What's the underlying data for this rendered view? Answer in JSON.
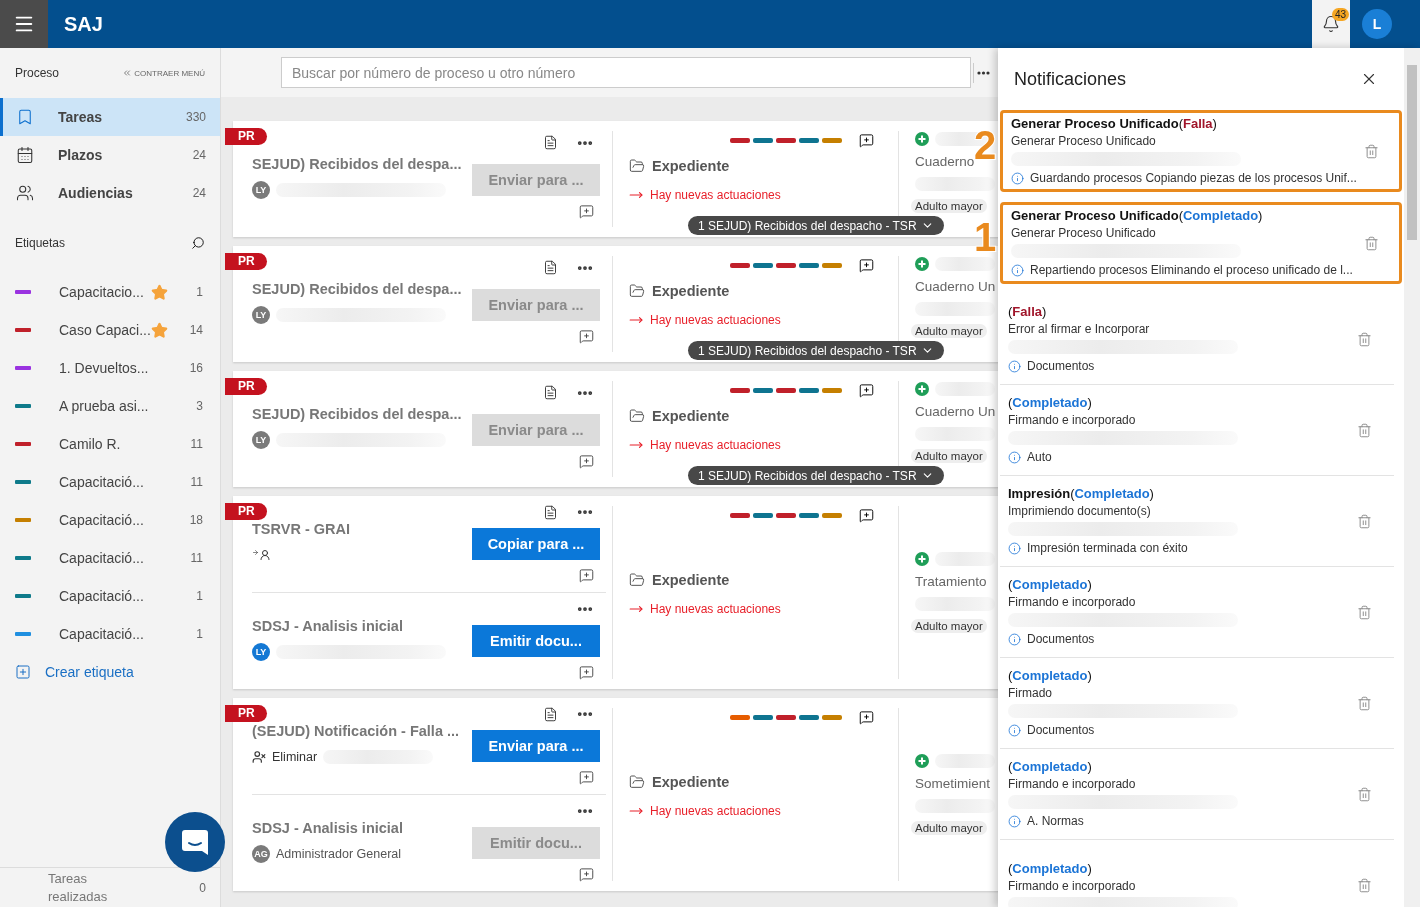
{
  "header": {
    "app_name": "SAJ",
    "bell": {
      "count": "43",
      "selected": true
    },
    "avatar_initial": "L"
  },
  "sidebar": {
    "section_title": "Proceso",
    "collapse_label": "CONTRAER MENÚ",
    "nav": [
      {
        "kind": "tasks",
        "label": "Tareas",
        "count": "330",
        "selected": true
      },
      {
        "kind": "deadlines",
        "label": "Plazos",
        "count": "24",
        "selected": false
      },
      {
        "kind": "hearings",
        "label": "Audiencias",
        "count": "24",
        "selected": false
      }
    ],
    "labels_title": "Etiquetas",
    "labels": [
      {
        "name": "Capacitacio...",
        "count": "1",
        "color": "#9a33e0",
        "starred": true
      },
      {
        "name": "Caso Capaci...",
        "count": "14",
        "color": "#c0202a",
        "starred": true
      },
      {
        "name": "1. Devueltos...",
        "count": "16",
        "color": "#9a33e0",
        "starred": false
      },
      {
        "name": "A prueba asi...",
        "count": "3",
        "color": "#0e7a8a",
        "starred": false
      },
      {
        "name": "Camilo R.",
        "count": "11",
        "color": "#c0202a",
        "starred": false
      },
      {
        "name": "Capacitació...",
        "count": "11",
        "color": "#0e7a8a",
        "starred": false
      },
      {
        "name": "Capacitació...",
        "count": "18",
        "color": "#c57f00",
        "starred": false
      },
      {
        "name": "Capacitació...",
        "count": "11",
        "color": "#0e7a8a",
        "starred": false
      },
      {
        "name": "Capacitació...",
        "count": "1",
        "color": "#0e7a8a",
        "starred": false
      },
      {
        "name": "Capacitació...",
        "count": "1",
        "color": "#1f8fe0",
        "starred": false
      }
    ],
    "create_label": "Crear etiqueta",
    "footer": {
      "label": "Tareas realizadas",
      "count": "0"
    }
  },
  "search": {
    "placeholder": "Buscar por número de proceso u otro número"
  },
  "cards": [
    {
      "flag": "PR",
      "tasks": [
        {
          "title": "SEJUD) Recibidos del despa...",
          "document_icon": true,
          "assignee": {
            "kind": "initials",
            "initials": "LY",
            "color": "#7a7a7a",
            "redacted": true
          },
          "button": {
            "label": "Enviar para ...",
            "enabled": false
          }
        }
      ],
      "strips": [
        {
          "color": "#c0202a"
        },
        {
          "color": "#0e7490"
        },
        {
          "color": "#c0202a"
        },
        {
          "color": "#0e7490"
        },
        {
          "color": "#c57f00"
        }
      ],
      "folder": "Expediente",
      "alert": "Hay nuevas actuaciones",
      "stage_pill": "1 SEJUD) Recibidos del despacho - TSR",
      "side": {
        "heading": "Cuaderno",
        "tag": "Adulto mayor"
      }
    },
    {
      "flag": "PR",
      "tasks": [
        {
          "title": "SEJUD) Recibidos del despa...",
          "document_icon": true,
          "assignee": {
            "kind": "initials",
            "initials": "LY",
            "color": "#7a7a7a",
            "redacted": true
          },
          "button": {
            "label": "Enviar para ...",
            "enabled": false
          }
        }
      ],
      "strips": [
        {
          "color": "#c0202a"
        },
        {
          "color": "#0e7490"
        },
        {
          "color": "#c0202a"
        },
        {
          "color": "#0e7490"
        },
        {
          "color": "#c57f00"
        }
      ],
      "folder": "Expediente",
      "alert": "Hay nuevas actuaciones",
      "stage_pill": "1 SEJUD) Recibidos del despacho - TSR",
      "side": {
        "heading": "Cuaderno Un",
        "tag": "Adulto mayor"
      }
    },
    {
      "flag": "PR",
      "tasks": [
        {
          "title": "SEJUD) Recibidos del despa...",
          "document_icon": true,
          "assignee": {
            "kind": "initials",
            "initials": "LY",
            "color": "#7a7a7a",
            "redacted": true
          },
          "button": {
            "label": "Enviar para ...",
            "enabled": false
          }
        }
      ],
      "strips": [
        {
          "color": "#c0202a"
        },
        {
          "color": "#0e7490"
        },
        {
          "color": "#c0202a"
        },
        {
          "color": "#0e7490"
        },
        {
          "color": "#c57f00"
        }
      ],
      "folder": "Expediente",
      "alert": "Hay nuevas actuaciones",
      "stage_pill": "1 SEJUD) Recibidos del despacho - TSR",
      "side": {
        "heading": "Cuaderno Un",
        "tag": "Adulto mayor"
      }
    },
    {
      "flag": "PR",
      "tasks": [
        {
          "title": "TSRVR - GRAI",
          "document_icon": true,
          "assignee": {
            "kind": "transfer",
            "redacted": false
          },
          "button": {
            "label": "Copiar para ...",
            "enabled": true
          }
        },
        {
          "title": "SDSJ - Analisis inicial",
          "document_icon": false,
          "assignee": {
            "kind": "initials",
            "initials": "LY",
            "color": "#1478d4",
            "redacted": true
          },
          "button": {
            "label": "Emitir docu...",
            "enabled": true
          }
        }
      ],
      "strips": [
        {
          "color": "#c0202a"
        },
        {
          "color": "#0e7490"
        },
        {
          "color": "#c0202a"
        },
        {
          "color": "#0e7490"
        },
        {
          "color": "#c57f00"
        }
      ],
      "folder": "Expediente",
      "alert": "Hay nuevas actuaciones",
      "side": {
        "heading": "Tratamiento",
        "tag": "Adulto mayor"
      }
    },
    {
      "flag": "PR",
      "tasks": [
        {
          "title": "(SEJUD) Notificación - Falla ...",
          "document_icon": true,
          "assignee": {
            "kind": "removed",
            "text": "Eliminar",
            "redacted": true
          },
          "button": {
            "label": "Enviar para ...",
            "enabled": true
          }
        },
        {
          "title": "SDSJ - Analisis inicial",
          "document_icon": false,
          "assignee": {
            "kind": "initials",
            "initials": "AG",
            "color": "#7a7a7a",
            "text": "Administrador General",
            "redacted": false
          },
          "button": {
            "label": "Emitir docu...",
            "enabled": false
          }
        }
      ],
      "strips": [
        {
          "color": "#e65c00"
        },
        {
          "color": "#0e7490"
        },
        {
          "color": "#c0202a"
        },
        {
          "color": "#0e7490"
        },
        {
          "color": "#c57f00"
        }
      ],
      "folder": "Expediente",
      "alert": "Hay nuevas actuaciones",
      "side": {
        "heading": "Sometimient",
        "tag": "Adulto mayor"
      }
    }
  ],
  "notifications": {
    "title": "Notificaciones",
    "items": [
      {
        "title": "Generar Proceso Unificado",
        "status": {
          "text": "(Falla)",
          "kind": "error"
        },
        "subtitle": "Generar Proceso Unificado",
        "info": "Guardando procesos Copiando piezas de los procesos Unif...",
        "callout": "2"
      },
      {
        "title": "Generar Proceso Unificado",
        "status": {
          "text": "(Completado)",
          "kind": "success"
        },
        "subtitle": "Generar Proceso Unificado",
        "info": "Repartiendo procesos Eliminando el proceso unificado de l...",
        "callout": "1"
      },
      {
        "status": {
          "text": "(Falla)",
          "kind": "error"
        },
        "subtitle": "Error al firmar e Incorporar",
        "info": "Documentos"
      },
      {
        "status": {
          "text": "(Completado)",
          "kind": "success"
        },
        "subtitle": "Firmando e incorporado",
        "info": "Auto"
      },
      {
        "title": "Impresión",
        "status": {
          "text": "(Completado)",
          "kind": "success"
        },
        "subtitle": "Imprimiendo documento(s)",
        "info": "Impresión terminada con éxito"
      },
      {
        "status": {
          "text": "(Completado)",
          "kind": "success"
        },
        "subtitle": "Firmando e incorporado",
        "info": "Documentos"
      },
      {
        "status": {
          "text": "(Completado)",
          "kind": "success"
        },
        "subtitle": "Firmado",
        "info": "Documentos"
      },
      {
        "status": {
          "text": "(Completado)",
          "kind": "success"
        },
        "subtitle": "Firmando e incorporado",
        "info": "A. Normas"
      },
      {
        "status": {
          "text": "(Completado)",
          "kind": "success"
        },
        "subtitle": "Firmando e incorporado"
      }
    ]
  }
}
